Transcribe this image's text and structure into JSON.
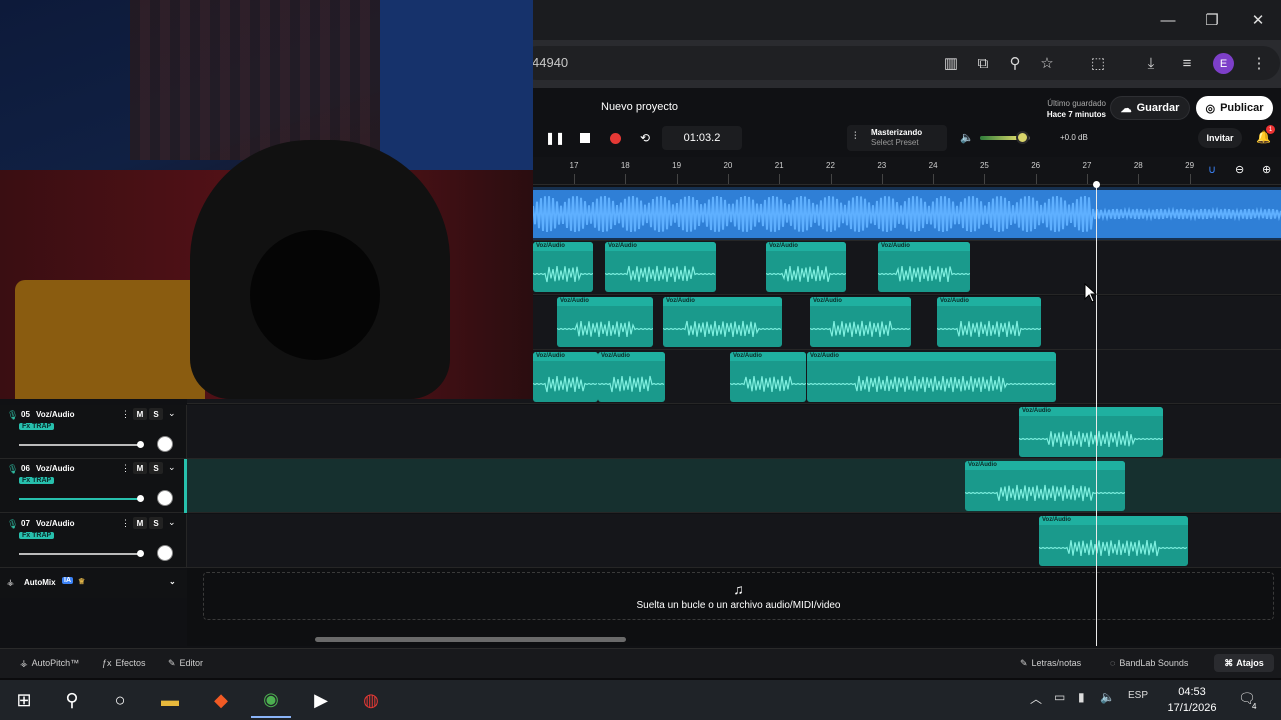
{
  "browser": {
    "url_fragment": "44940",
    "window_buttons": {
      "minimize": "—",
      "maximize": "❐",
      "close": "✕"
    },
    "profile_initial": "E"
  },
  "project": {
    "title": "Nuevo proyecto",
    "last_saved_label": "Último guardado",
    "last_saved_value": "Hace 7 minutos",
    "save_label": "Guardar",
    "publish_label": "Publicar",
    "invite_label": "Invitar",
    "notification_count": "1"
  },
  "transport": {
    "time": "01:03.2",
    "mastering_title": "Masterizando",
    "mastering_preset": "Select Preset",
    "volume_level": 0.75,
    "volume_db": "+0.0 dB"
  },
  "ruler": {
    "bars": [
      "17",
      "18",
      "19",
      "20",
      "21",
      "22",
      "23",
      "24",
      "25",
      "26",
      "27",
      "28",
      "29"
    ]
  },
  "tracks": [
    {
      "number": "05",
      "name": "Voz/Audio",
      "fx": "Fx TRAP",
      "mute": "M",
      "solo": "S"
    },
    {
      "number": "06",
      "name": "Voz/Audio",
      "fx": "Fx TRAP",
      "mute": "M",
      "solo": "S"
    },
    {
      "number": "07",
      "name": "Voz/Audio",
      "fx": "Fx TRAP",
      "mute": "M",
      "solo": "S"
    }
  ],
  "clip_label": "Voz/Audio",
  "automix": {
    "label": "AutoMix",
    "badge": "IA"
  },
  "dropzone": {
    "text": "Suelta un bucle o un archivo audio/MIDI/video"
  },
  "bottom_bar": {
    "autopitch": "AutoPitch™",
    "effects": "Efectos",
    "editor": "Editor",
    "lyrics": "Letras/notas",
    "sounds": "BandLab Sounds",
    "shortcuts": "Atajos"
  },
  "taskbar": {
    "language": "ESP",
    "time": "04:53",
    "date": "17/1/2026",
    "notifications": "4"
  },
  "colors": {
    "accent_teal": "#1a9a8c",
    "master_wave": "#2f7fd6",
    "record": "#e53935",
    "publish_bg": "#ffffff"
  }
}
